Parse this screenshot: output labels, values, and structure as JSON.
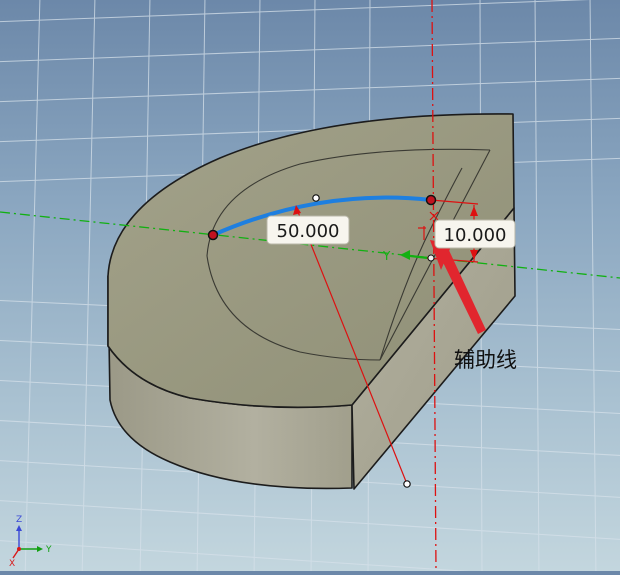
{
  "viewport": {
    "dimension_radius": "50.000",
    "dimension_offset": "10.000",
    "annotation_label": "辅助线",
    "sketch_axis_label": "Y"
  },
  "triad": {
    "z_label": "Z",
    "y_label": "Y",
    "x_label": "X"
  },
  "colors": {
    "background_top": "#6c88a9",
    "background_bottom": "#c3d6de",
    "solid_top_face": "#9a9a82",
    "solid_side_face": "#a7a592",
    "arc_highlight": "#1e7fe0",
    "dimension_red": "#dd1111",
    "axis_green": "#12b012"
  }
}
